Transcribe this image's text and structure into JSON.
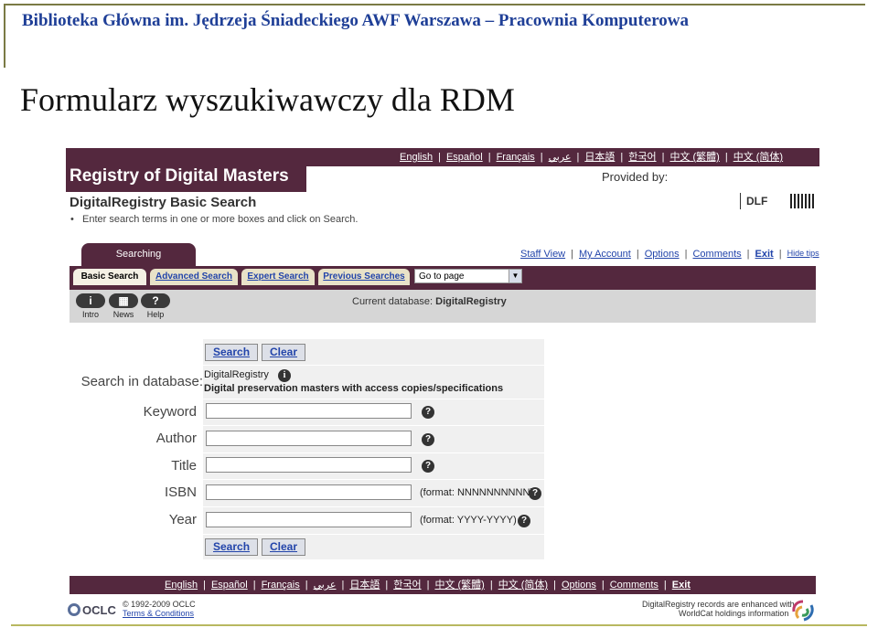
{
  "slide": {
    "header": "Biblioteka Główna im. Jędrzeja Śniadeckiego AWF Warszawa – Pracownia Komputerowa",
    "title": "Formularz wyszukiwawczy dla RDM"
  },
  "banner": {
    "title": "Registry of Digital Masters",
    "languages": [
      "English",
      "Español",
      "Français",
      "عربي",
      "日本語",
      "한국어",
      "中文 (繁體)",
      "中文 (简体)"
    ],
    "provided_by": "Provided by:",
    "logo_dlf": "DLF"
  },
  "page": {
    "subtitle": "DigitalRegistry Basic Search",
    "help_text": "Enter search terms in one or more boxes and click on Search."
  },
  "tabs": {
    "searching": "Searching",
    "items": [
      "Basic Search",
      "Advanced Search",
      "Expert Search",
      "Previous Searches"
    ],
    "goto": "Go to page"
  },
  "user_links": [
    "Staff View",
    "My Account",
    "Options",
    "Comments",
    "Exit",
    "Hide tips"
  ],
  "iconbar": {
    "buttons": [
      {
        "glyph": "i",
        "label": "Intro"
      },
      {
        "glyph": "▦",
        "label": "News"
      },
      {
        "glyph": "?",
        "label": "Help"
      }
    ],
    "current_db_label": "Current database:",
    "current_db": "DigitalRegistry"
  },
  "form": {
    "search_btn": "Search",
    "clear_btn": "Clear",
    "db_label": "Search in database:",
    "db_name": "DigitalRegistry",
    "db_desc": "Digital preservation masters with access copies/specifications",
    "fields": [
      {
        "label": "Keyword",
        "value": "",
        "format": ""
      },
      {
        "label": "Author",
        "value": "",
        "format": ""
      },
      {
        "label": "Title",
        "value": "",
        "format": ""
      },
      {
        "label": "ISBN",
        "value": "",
        "format": "(format: NNNNNNNNNN)"
      },
      {
        "label": "Year",
        "value": "",
        "format": "(format: YYYY-YYYY)"
      }
    ]
  },
  "footer": {
    "links": [
      "English",
      "Español",
      "Français",
      "عربي",
      "日本語",
      "한국어",
      "中文 (繁體)",
      "中文 (简体)",
      "Options",
      "Comments",
      "Exit"
    ],
    "oclc": "OCLC",
    "copyright": "© 1992-2009 OCLC",
    "terms": "Terms & Conditions",
    "enhanced_1": "DigitalRegistry records are enhanced with",
    "enhanced_2": "WorldCat holdings information"
  },
  "colors": {
    "brand": "#54283e",
    "link": "#2244aa",
    "slide_header": "#1f3f97"
  }
}
